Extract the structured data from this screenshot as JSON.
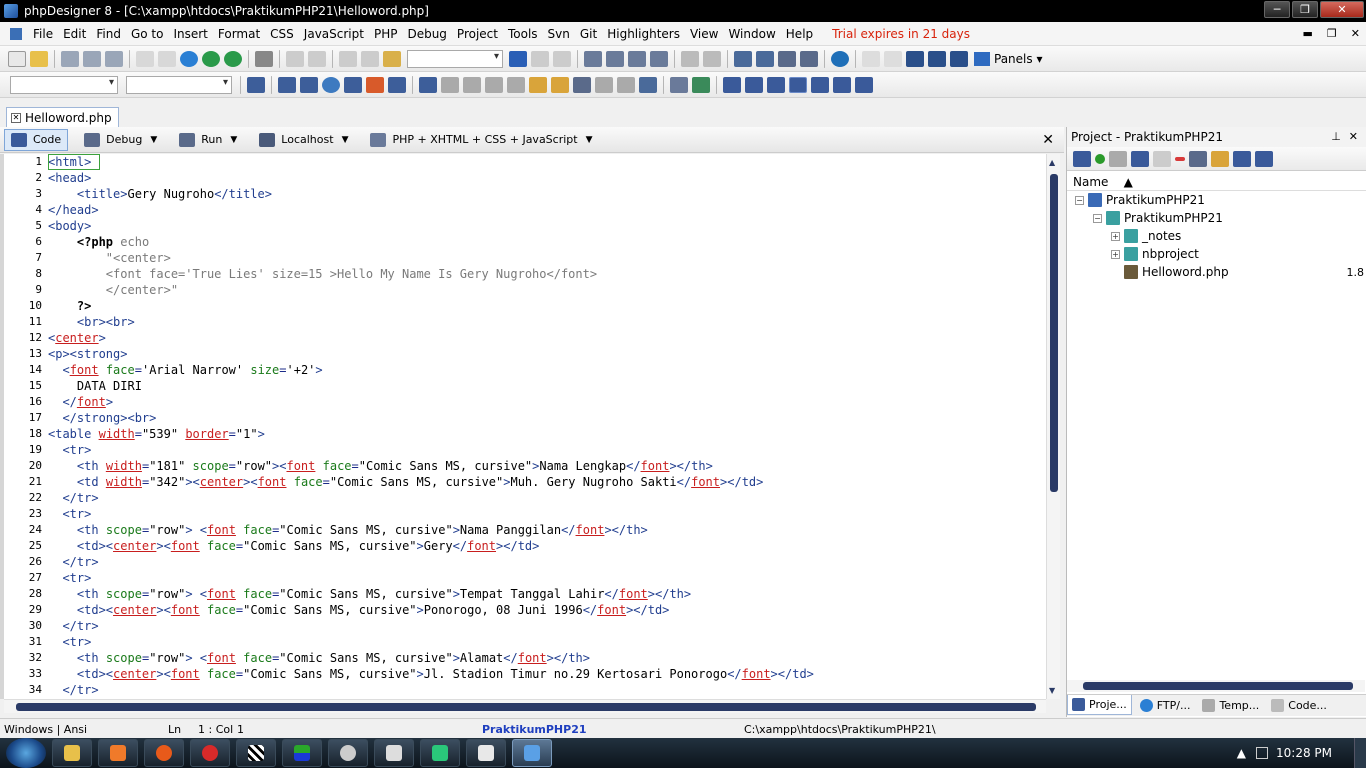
{
  "window": {
    "title": "phpDesigner 8 - [C:\\xampp\\htdocs\\PraktikumPHP21\\Helloword.php]",
    "minimize": "─",
    "maximize": "❐",
    "close": "✕"
  },
  "menu": {
    "items": [
      "File",
      "Edit",
      "Find",
      "Go to",
      "Insert",
      "Format",
      "CSS",
      "JavaScript",
      "PHP",
      "Debug",
      "Project",
      "Tools",
      "Svn",
      "Git",
      "Highlighters",
      "View",
      "Window",
      "Help"
    ],
    "trial": "Trial expires in 21 days",
    "mdi": [
      "▬",
      "❐",
      "✕"
    ]
  },
  "toolbar": {
    "panels_label": "Panels"
  },
  "doc_tab": {
    "label": "Helloword.php"
  },
  "editor_toolbar": {
    "code": "Code",
    "debug": "Debug",
    "run": "Run",
    "localhost": "Localhost",
    "language": "PHP + XHTML + CSS + JavaScript"
  },
  "code_lines": [
    {
      "n": "1",
      "html": "<span class='t'>&lt;html&gt;</span>"
    },
    {
      "n": "2",
      "html": "<span class='t'>&lt;head&gt;</span>"
    },
    {
      "n": "3",
      "html": "    <span class='t'>&lt;title&gt;</span><span class='s'>Gery Nugroho</span><span class='t'>&lt;/title&gt;</span>"
    },
    {
      "n": "4",
      "html": "<span class='t'>&lt;/head&gt;</span>"
    },
    {
      "n": "5",
      "html": "<span class='t'>&lt;body&gt;</span>"
    },
    {
      "n": "6",
      "html": "    <span class='b'><b>&lt;?php</b></span> <span class='g'>echo</span>"
    },
    {
      "n": "7",
      "html": "        <span class='g'>\"&lt;center&gt;</span>"
    },
    {
      "n": "8",
      "html": "        <span class='g'>&lt;font face='True Lies' size=15 &gt;Hello My Name Is Gery Nugroho&lt;/font&gt;</span>"
    },
    {
      "n": "9",
      "html": "        <span class='g'>&lt;/center&gt;\"</span>"
    },
    {
      "n": "10",
      "html": "    <span class='b'><b>?&gt;</b></span>"
    },
    {
      "n": "11",
      "html": "    <span class='t'>&lt;br&gt;&lt;br&gt;</span>"
    },
    {
      "n": "12",
      "html": "<span class='t'>&lt;</span><span class='r'>center</span><span class='t'>&gt;</span>"
    },
    {
      "n": "13",
      "html": "<span class='t'>&lt;p&gt;&lt;strong&gt;</span>"
    },
    {
      "n": "14",
      "html": "  <span class='t'>&lt;</span><span class='r'>font</span> <span class='a'>face</span>=<span class='s'>'Arial Narrow'</span> <span class='a'>size</span>=<span class='s'>'+2'</span><span class='t'>&gt;</span>"
    },
    {
      "n": "15",
      "html": "    <span class='s'>DATA DIRI</span>"
    },
    {
      "n": "16",
      "html": "  <span class='t'>&lt;/</span><span class='r'>font</span><span class='t'>&gt;</span>"
    },
    {
      "n": "17",
      "html": "  <span class='t'>&lt;/strong&gt;&lt;br&gt;</span>"
    },
    {
      "n": "18",
      "html": "<span class='t'>&lt;table</span> <span class='r'>width</span>=<span class='s'>\"539\"</span> <span class='r'>border</span>=<span class='s'>\"1\"</span><span class='t'>&gt;</span>"
    },
    {
      "n": "19",
      "html": "  <span class='t'>&lt;tr&gt;</span>"
    },
    {
      "n": "20",
      "html": "    <span class='t'>&lt;th</span> <span class='r'>width</span>=<span class='s'>\"181\"</span> <span class='a'>scope</span>=<span class='s'>\"row\"</span><span class='t'>&gt;&lt;</span><span class='r'>font</span> <span class='a'>face</span>=<span class='s'>\"Comic Sans MS, cursive\"</span><span class='t'>&gt;</span><span class='s'>Nama Lengkap</span><span class='t'>&lt;/</span><span class='r'>font</span><span class='t'>&gt;&lt;/th&gt;</span>"
    },
    {
      "n": "21",
      "html": "    <span class='t'>&lt;td</span> <span class='r'>width</span>=<span class='s'>\"342\"</span><span class='t'>&gt;&lt;</span><span class='r'>center</span><span class='t'>&gt;&lt;</span><span class='r'>font</span> <span class='a'>face</span>=<span class='s'>\"Comic Sans MS, cursive\"</span><span class='t'>&gt;</span><span class='s'>Muh. Gery Nugroho Sakti</span><span class='t'>&lt;/</span><span class='r'>font</span><span class='t'>&gt;&lt;/td&gt;</span>"
    },
    {
      "n": "22",
      "html": "  <span class='t'>&lt;/tr&gt;</span>"
    },
    {
      "n": "23",
      "html": "  <span class='t'>&lt;tr&gt;</span>"
    },
    {
      "n": "24",
      "html": "    <span class='t'>&lt;th</span> <span class='a'>scope</span>=<span class='s'>\"row\"</span><span class='t'>&gt;</span> <span class='t'>&lt;</span><span class='r'>font</span> <span class='a'>face</span>=<span class='s'>\"Comic Sans MS, cursive\"</span><span class='t'>&gt;</span><span class='s'>Nama Panggilan</span><span class='t'>&lt;/</span><span class='r'>font</span><span class='t'>&gt;&lt;/th&gt;</span>"
    },
    {
      "n": "25",
      "html": "    <span class='t'>&lt;td&gt;&lt;</span><span class='r'>center</span><span class='t'>&gt;&lt;</span><span class='r'>font</span> <span class='a'>face</span>=<span class='s'>\"Comic Sans MS, cursive\"</span><span class='t'>&gt;</span><span class='s'>Gery</span><span class='t'>&lt;/</span><span class='r'>font</span><span class='t'>&gt;&lt;/td&gt;</span>"
    },
    {
      "n": "26",
      "html": "  <span class='t'>&lt;/tr&gt;</span>"
    },
    {
      "n": "27",
      "html": "  <span class='t'>&lt;tr&gt;</span>"
    },
    {
      "n": "28",
      "html": "    <span class='t'>&lt;th</span> <span class='a'>scope</span>=<span class='s'>\"row\"</span><span class='t'>&gt;</span> <span class='t'>&lt;</span><span class='r'>font</span> <span class='a'>face</span>=<span class='s'>\"Comic Sans MS, cursive\"</span><span class='t'>&gt;</span><span class='s'>Tempat Tanggal Lahir</span><span class='t'>&lt;/</span><span class='r'>font</span><span class='t'>&gt;&lt;/th&gt;</span>"
    },
    {
      "n": "29",
      "html": "    <span class='t'>&lt;td&gt;&lt;</span><span class='r'>center</span><span class='t'>&gt;&lt;</span><span class='r'>font</span> <span class='a'>face</span>=<span class='s'>\"Comic Sans MS, cursive\"</span><span class='t'>&gt;</span><span class='s'>Ponorogo, 08 Juni 1996</span><span class='t'>&lt;/</span><span class='r'>font</span><span class='t'>&gt;&lt;/td&gt;</span>"
    },
    {
      "n": "30",
      "html": "  <span class='t'>&lt;/tr&gt;</span>"
    },
    {
      "n": "31",
      "html": "  <span class='t'>&lt;tr&gt;</span>"
    },
    {
      "n": "32",
      "html": "    <span class='t'>&lt;th</span> <span class='a'>scope</span>=<span class='s'>\"row\"</span><span class='t'>&gt;</span> <span class='t'>&lt;</span><span class='r'>font</span> <span class='a'>face</span>=<span class='s'>\"Comic Sans MS, cursive\"</span><span class='t'>&gt;</span><span class='s'>Alamat</span><span class='t'>&lt;/</span><span class='r'>font</span><span class='t'>&gt;&lt;/th&gt;</span>"
    },
    {
      "n": "33",
      "html": "    <span class='t'>&lt;td&gt;&lt;</span><span class='r'>center</span><span class='t'>&gt;&lt;</span><span class='r'>font</span> <span class='a'>face</span>=<span class='s'>\"Comic Sans MS, cursive\"</span><span class='t'>&gt;</span><span class='s'>Jl. Stadion Timur no.29 Kertosari Ponorogo</span><span class='t'>&lt;/</span><span class='r'>font</span><span class='t'>&gt;&lt;/td&gt;</span>"
    },
    {
      "n": "34",
      "html": "  <span class='t'>&lt;/tr&gt;</span>"
    }
  ],
  "project_panel": {
    "title": "Project - PraktikumPHP21",
    "column_name": "Name",
    "tree": [
      {
        "label": "PraktikumPHP21",
        "exp": "−",
        "indent": "root",
        "icon": "project-icon"
      },
      {
        "label": "PraktikumPHP21",
        "exp": "−",
        "indent": "l1",
        "icon": "folder-icon"
      },
      {
        "label": "_notes",
        "exp": "+",
        "indent": "l2",
        "icon": "folder-icon"
      },
      {
        "label": "nbproject",
        "exp": "+",
        "indent": "l2",
        "icon": "folder-icon"
      },
      {
        "label": "Helloword.php",
        "exp": "",
        "indent": "l2",
        "icon": "php-file-icon",
        "size": "1.8"
      }
    ],
    "tabs": [
      "Proje...",
      "FTP/...",
      "Temp...",
      "Code..."
    ]
  },
  "status": {
    "line_endings": "Windows | Ansi",
    "ln_label": "Ln",
    "pos": "1 : Col",
    "col": "1",
    "project": "PraktikumPHP21",
    "path": "C:\\xampp\\htdocs\\PraktikumPHP21\\"
  },
  "taskbar": {
    "clock": "10:28 PM"
  },
  "colors": {
    "accent": "#2a3a66",
    "trial": "#d8230c",
    "error_underline": "#c81e1e"
  }
}
